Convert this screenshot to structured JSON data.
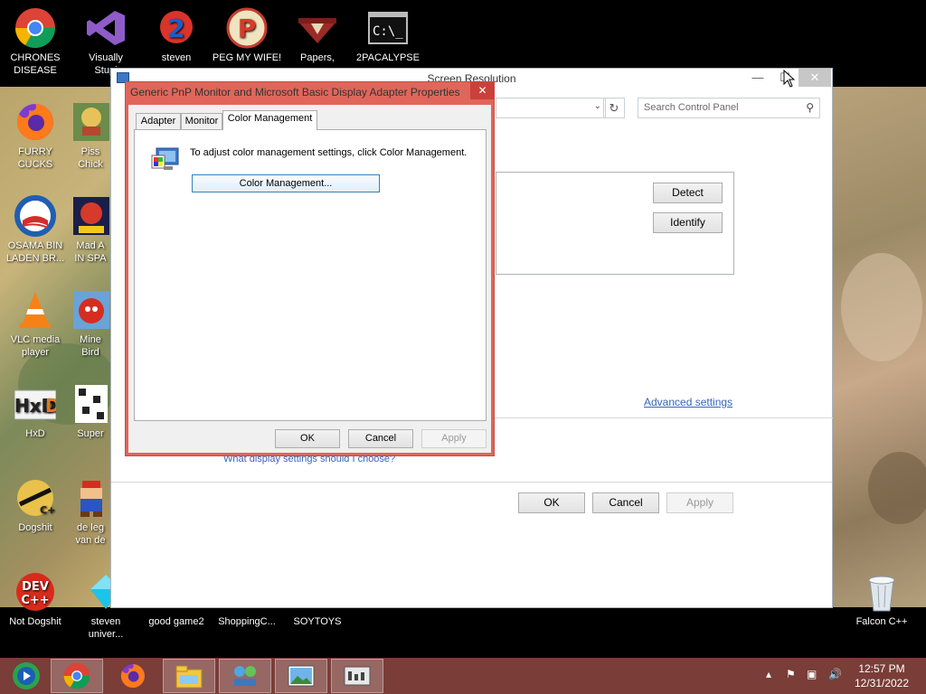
{
  "desktop": {
    "icons": [
      {
        "label": "CHRONES\nDISEASE",
        "icon": "chrome-icon"
      },
      {
        "label": "Visually\nStupi",
        "icon": "visual-studio-icon"
      },
      {
        "label": "steven",
        "icon": "steven-icon"
      },
      {
        "label": "PEG MY WIFE!",
        "icon": "peggle-icon"
      },
      {
        "label": "Papers,",
        "icon": "papers-please-icon"
      },
      {
        "label": "2PACALYPSE",
        "icon": "cmd-icon"
      },
      {
        "label": "FURRY CUCKS",
        "icon": "firefox-icon"
      },
      {
        "label": "Piss\nChick",
        "icon": "game-icon"
      },
      {
        "label": "OSAMA BIN\nLADEN BR...",
        "icon": "obama-logo-icon"
      },
      {
        "label": "Mad A\nIN SPA",
        "icon": "angry-birds-space-icon"
      },
      {
        "label": "VLC media\nplayer",
        "icon": "vlc-icon"
      },
      {
        "label": "Mine\nBird",
        "icon": "angry-birds-icon"
      },
      {
        "label": "HxD",
        "icon": "hxd-icon"
      },
      {
        "label": "Super",
        "icon": "pixel-game-icon"
      },
      {
        "label": "Dogshit",
        "icon": "cpp-icon"
      },
      {
        "label": "de leg\nvan de",
        "icon": "mario-icon"
      },
      {
        "label": "Not Dogshit",
        "icon": "dev-cpp-icon"
      },
      {
        "label": "steven\nuniver...",
        "icon": "diamond-icon"
      },
      {
        "label": "good game2",
        "icon": "blank-icon"
      },
      {
        "label": "ShoppingC...",
        "icon": "blank-icon"
      },
      {
        "label": "SOYTOYS",
        "icon": "blank-icon"
      },
      {
        "label": "Falcon C++",
        "icon": "recycle-bin-icon"
      }
    ]
  },
  "screen_resolution_window": {
    "title": "Screen Resolution",
    "search_placeholder": "Search Control Panel",
    "detect_label": "Detect",
    "identify_label": "Identify",
    "advanced_link": "Advanced settings",
    "help_link": "What display settings should I choose?",
    "ok_label": "OK",
    "cancel_label": "Cancel",
    "apply_label": "Apply"
  },
  "properties_dialog": {
    "title": "Generic PnP Monitor and Microsoft Basic Display Adapter Properties",
    "tabs": [
      "Adapter",
      "Monitor",
      "Color Management"
    ],
    "active_tab": "Color Management",
    "description": "To adjust color management settings, click Color Management.",
    "color_management_button": "Color Management...",
    "ok_label": "OK",
    "cancel_label": "Cancel",
    "apply_label": "Apply"
  },
  "taskbar": {
    "items": [
      "windows-media-center-icon",
      "chrome-icon",
      "firefox-icon",
      "file-explorer-icon",
      "network-icon",
      "photos-icon",
      "control-panel-icon"
    ],
    "clock_time": "12:57 PM",
    "clock_date": "12/31/2022"
  },
  "colors": {
    "dialog_frame": "#e0665b",
    "taskbar": "#7a3d38",
    "link": "#3366bb"
  }
}
